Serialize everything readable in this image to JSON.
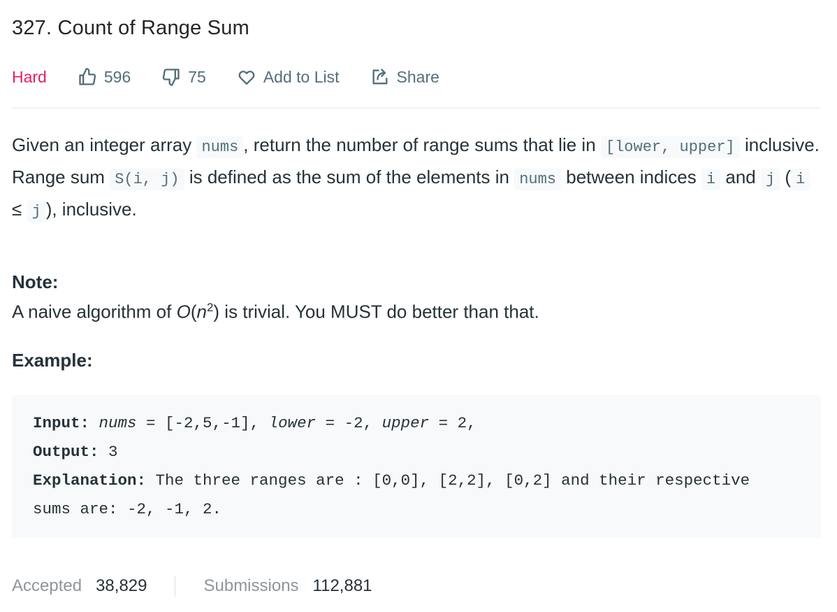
{
  "problem": {
    "title": "327. Count of Range Sum",
    "difficulty": "Hard",
    "likes": "596",
    "dislikes": "75",
    "add_to_list_label": "Add to List",
    "share_label": "Share"
  },
  "description": {
    "line1_a": "Given an integer array ",
    "code_nums": "nums",
    "line1_b": ", return the number of range sums that lie in ",
    "code_range": "[lower, upper]",
    "line1_c": " inclusive.",
    "line2_a": "Range sum ",
    "code_sij": "S(i, j)",
    "line2_b": " is defined as the sum of the elements in ",
    "line2_c": " between indices ",
    "code_i": "i",
    "line2_d": " and ",
    "code_j": "j",
    "paren_open": " (",
    "leq": " ≤ ",
    "line2_e": "), inclusive."
  },
  "note": {
    "heading": "Note:",
    "text_a": "A naive algorithm of ",
    "o": "O",
    "paren": "(",
    "n": "n",
    "exp": "2",
    "text_b": ") is trivial. You MUST do better than that."
  },
  "example": {
    "heading": "Example:",
    "input_label": "Input:",
    "input_nums": "nums",
    "input_mid1": " = [-2,5,-1], ",
    "input_lower": "lower",
    "input_mid2": " = -2, ",
    "input_upper": "upper",
    "input_end": " = 2,",
    "output_label": "Output:",
    "output_value": " 3",
    "explanation_label": "Explanation:",
    "explanation_line1": " The three ranges are : [0,0], [2,2], [0,2] and their respective",
    "explanation_line2": "sums are: -2, -1, 2."
  },
  "stats": {
    "accepted_label": "Accepted",
    "accepted_value": "38,829",
    "submissions_label": "Submissions",
    "submissions_value": "112,881"
  },
  "colors": {
    "difficulty_hard": "#e91e63",
    "text": "#263238",
    "muted": "#546e7a",
    "code_bg": "#f7f9fa"
  }
}
